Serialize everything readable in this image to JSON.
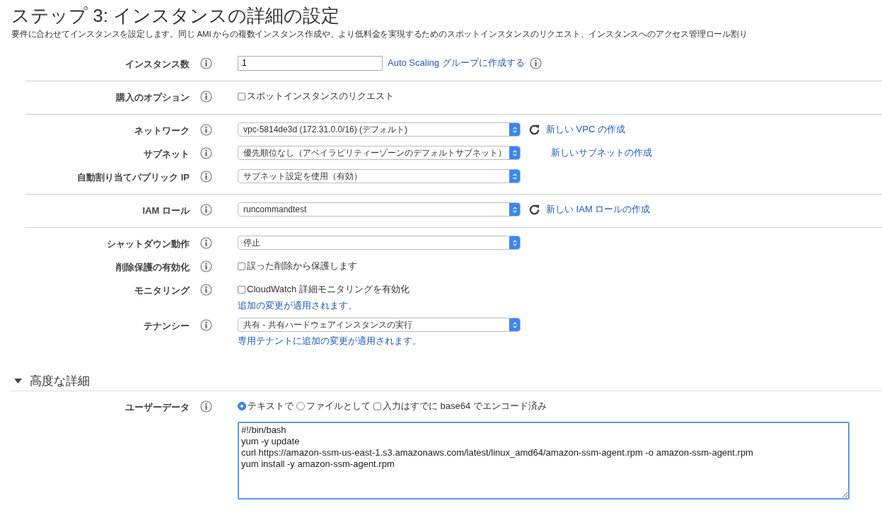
{
  "title": "ステップ 3: インスタンスの詳細の設定",
  "description": "要件に合わせてインスタンスを設定します。同じ AMI からの複数インスタンス作成や、より低料金を実現するためのスポットインスタンスのリクエスト、インスタンスへのアクセス管理ロール割り",
  "sections": [
    {
      "rows": [
        {
          "label": "インスタンス数",
          "control": {
            "kind": "input",
            "value": "1"
          },
          "link": "Auto Scaling グループに作成する",
          "link_info": true
        }
      ]
    },
    {
      "rows": [
        {
          "label": "購入のオプション",
          "control": {
            "kind": "checkbox",
            "text": "スポットインスタンスのリクエスト",
            "checked": false
          }
        }
      ]
    },
    {
      "rows": [
        {
          "label": "ネットワーク",
          "control": {
            "kind": "select",
            "value": "vpc-5814de3d (172.31.0.0/16) (デフォルト)"
          },
          "refresh": true,
          "link": "新しい VPC の作成"
        },
        {
          "label": "サブネット",
          "control": {
            "kind": "select",
            "value": "優先順位なし（アベイラビリティーゾーンのデフォルトサブネット）"
          },
          "link": "新しいサブネットの作成"
        },
        {
          "label": "自動割り当てパブリック IP",
          "control": {
            "kind": "select",
            "value": "サブネット設定を使用（有効）"
          }
        }
      ]
    },
    {
      "rows": [
        {
          "label": "IAM ロール",
          "control": {
            "kind": "select",
            "value": "runcommandtest"
          },
          "refresh": true,
          "link": "新しい IAM ロールの作成"
        }
      ]
    },
    {
      "rows": [
        {
          "label": "シャットダウン動作",
          "control": {
            "kind": "select",
            "value": "停止"
          }
        },
        {
          "label": "削除保護の有効化",
          "control": {
            "kind": "checkbox",
            "text": "誤った削除から保護します",
            "checked": false
          }
        },
        {
          "label": "モニタリング",
          "control": {
            "kind": "checkbox",
            "text": "CloudWatch 詳細モニタリングを有効化",
            "checked": false
          },
          "note": "追加の変更が適用されます。"
        },
        {
          "label": "テナンシー",
          "control": {
            "kind": "select",
            "value": "共有 - 共有ハードウェアインスタンスの実行"
          },
          "note": "専用テナントに追加の変更が適用されます。"
        }
      ]
    }
  ],
  "advanced": {
    "title": "高度な詳細",
    "expanded": true,
    "rows": [
      {
        "label": "ユーザーデータ",
        "control": {
          "kind": "options",
          "items": [
            {
              "kind": "radio",
              "text": "テキストで",
              "selected": true
            },
            {
              "kind": "radio",
              "text": "ファイルとして",
              "selected": false
            },
            {
              "kind": "checkbox",
              "text": "入力はすでに base64 でエンコード済み",
              "checked": false
            }
          ]
        }
      },
      {
        "label": "",
        "control": {
          "kind": "textarea",
          "lines": [
            "#!/bin/bash",
            "yum -y update",
            "curl https://amazon-ssm-us-east-1.s3.amazonaws.com/latest/linux_amd64/amazon-ssm-agent.rpm -o amazon-ssm-agent.rpm",
            "yum install -y amazon-ssm-agent.rpm"
          ]
        }
      }
    ]
  }
}
